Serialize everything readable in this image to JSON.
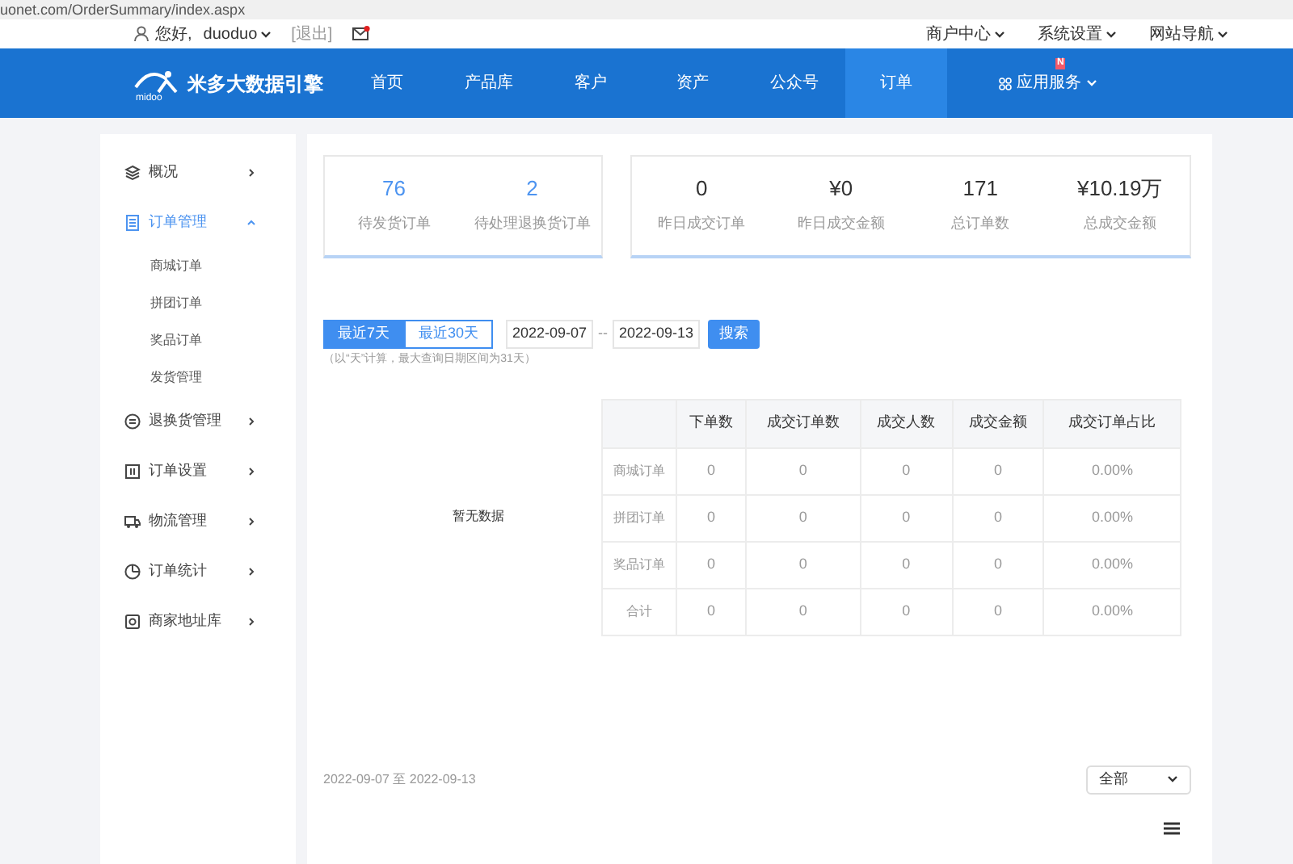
{
  "address_bar": {
    "url": "uonet.com/OrderSummary/index.aspx"
  },
  "user_bar": {
    "greeting": "您好,",
    "username": "duoduo",
    "logout": "[退出]",
    "has_unread_mail": true,
    "menus": [
      {
        "label": "商户中心"
      },
      {
        "label": "系统设置"
      },
      {
        "label": "网站导航"
      }
    ]
  },
  "nav": {
    "brand": "米多大数据引擎",
    "logo_text": "midoo",
    "items": [
      {
        "label": "首页",
        "selected": false
      },
      {
        "label": "产品库",
        "selected": false
      },
      {
        "label": "客户",
        "selected": false
      },
      {
        "label": "资产",
        "selected": false
      },
      {
        "label": "公众号",
        "selected": false
      },
      {
        "label": "订单",
        "selected": true
      },
      {
        "label": "应用服务",
        "selected": false,
        "badge": "N",
        "kind": "dropdown"
      }
    ]
  },
  "sidebar": {
    "items": [
      {
        "label": "概况",
        "selected": false,
        "expanded": false
      },
      {
        "label": "订单管理",
        "selected": true,
        "expanded": true,
        "children": [
          {
            "label": "商城订单"
          },
          {
            "label": "拼团订单"
          },
          {
            "label": "奖品订单"
          },
          {
            "label": "发货管理"
          }
        ]
      },
      {
        "label": "退换货管理",
        "selected": false,
        "expanded": false
      },
      {
        "label": "订单设置",
        "selected": false,
        "expanded": false
      },
      {
        "label": "物流管理",
        "selected": false,
        "expanded": false
      },
      {
        "label": "订单统计",
        "selected": false,
        "expanded": false
      },
      {
        "label": "商家地址库",
        "selected": false,
        "expanded": false
      }
    ]
  },
  "stat_cards": [
    {
      "stats": [
        {
          "value": "76",
          "label": "待发货订单",
          "highlight": true
        },
        {
          "value": "2",
          "label": "待处理退换货订单",
          "highlight": true
        }
      ]
    },
    {
      "stats": [
        {
          "value": "0",
          "label": "昨日成交订单",
          "highlight": false
        },
        {
          "value": "¥0",
          "label": "昨日成交金额",
          "highlight": false
        },
        {
          "value": "171",
          "label": "总订单数",
          "highlight": false
        },
        {
          "value": "¥10.19万",
          "label": "总成交金额",
          "highlight": false
        }
      ]
    }
  ],
  "filter": {
    "ranges": [
      {
        "label": "最近7天",
        "selected": true
      },
      {
        "label": "最近30天",
        "selected": false
      }
    ],
    "start_date": "2022-09-07",
    "separator": "--",
    "end_date": "2022-09-13",
    "search_button": "搜索",
    "hint": "（以“天”计算，最大查询日期区间为31天）"
  },
  "empty_chart": {
    "message": "暂无数据"
  },
  "table": {
    "columns": [
      "",
      "下单数",
      "成交订单数",
      "成交人数",
      "成交金额",
      "成交订单占比"
    ],
    "rows": [
      [
        "商城订单",
        "0",
        "0",
        "0",
        "0",
        "0.00%"
      ],
      [
        "拼团订单",
        "0",
        "0",
        "0",
        "0",
        "0.00%"
      ],
      [
        "奖品订单",
        "0",
        "0",
        "0",
        "0",
        "0.00%"
      ],
      [
        "合计",
        "0",
        "0",
        "0",
        "0",
        "0.00%"
      ]
    ]
  },
  "footer": {
    "range_text": "2022-09-07 至 2022-09-13",
    "select_value": "全部"
  }
}
